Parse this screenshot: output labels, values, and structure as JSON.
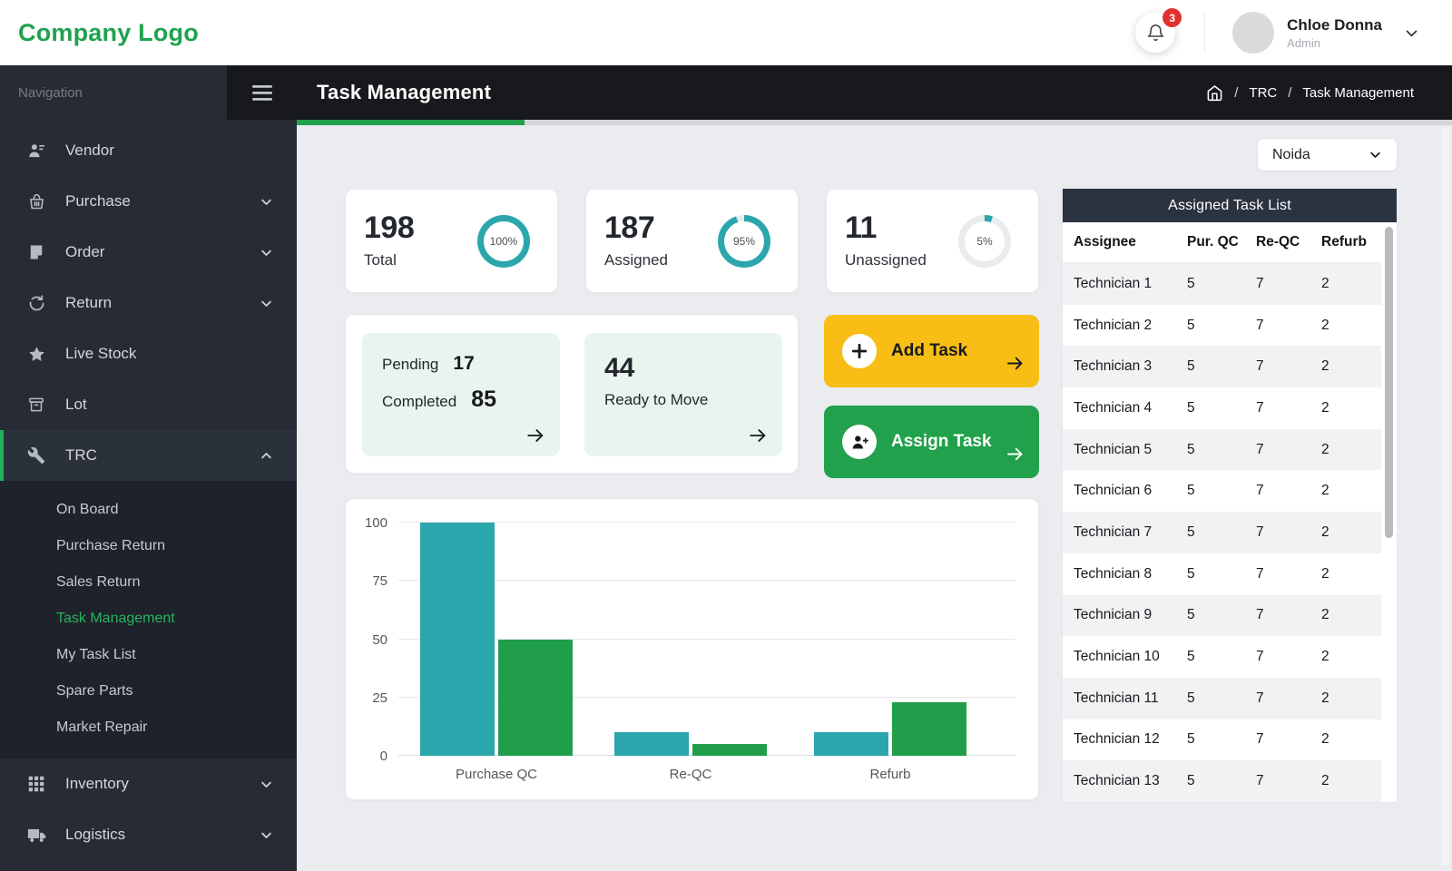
{
  "colors": {
    "green": "#21a14b",
    "green_bright": "#28b45e",
    "teal": "#2ca6ad",
    "yellow": "#f8be15",
    "red": "#e03131",
    "dark": "#17191d",
    "table_header_navy": "#2c3340",
    "mint": "#e9f4ee",
    "ring_track": "#e9ebee"
  },
  "header": {
    "logo": "Company Logo",
    "notification_badge": "3",
    "user_name": "Chloe Donna",
    "user_role": "Admin"
  },
  "sidebar": {
    "nav_label": "Navigation",
    "items": [
      {
        "id": "vendor",
        "label": "Vendor",
        "icon": "vendor-icon"
      },
      {
        "id": "purchase",
        "label": "Purchase",
        "icon": "basket-icon",
        "expandable": true,
        "expanded": false
      },
      {
        "id": "order",
        "label": "Order",
        "icon": "note-icon",
        "expandable": true,
        "expanded": false
      },
      {
        "id": "return",
        "label": "Return",
        "icon": "return-icon",
        "expandable": true,
        "expanded": false
      },
      {
        "id": "live-stock",
        "label": "Live Stock",
        "icon": "star-icon"
      },
      {
        "id": "lot",
        "label": "Lot",
        "icon": "archive-icon"
      },
      {
        "id": "trc",
        "label": "TRC",
        "icon": "wrench-icon",
        "expandable": true,
        "expanded": true,
        "active": true,
        "children": [
          {
            "id": "on-board",
            "label": "On Board"
          },
          {
            "id": "purchase-return",
            "label": "Purchase Return"
          },
          {
            "id": "sales-return",
            "label": "Sales Return"
          },
          {
            "id": "task-management",
            "label": "Task Management",
            "active": true
          },
          {
            "id": "my-task-list",
            "label": "My Task List"
          },
          {
            "id": "spare-parts",
            "label": "Spare Parts"
          },
          {
            "id": "market-repair",
            "label": "Market Repair"
          }
        ]
      },
      {
        "id": "inventory",
        "label": "Inventory",
        "icon": "grid-icon",
        "expandable": true,
        "expanded": false
      },
      {
        "id": "logistics",
        "label": "Logistics",
        "icon": "truck-icon",
        "expandable": true,
        "expanded": false
      }
    ]
  },
  "titlebar": {
    "title": "Task Management",
    "breadcrumb": [
      "TRC",
      "Task Management"
    ]
  },
  "filters": {
    "location": "Noida"
  },
  "stats": [
    {
      "value": "198",
      "label": "Total",
      "percent": 100,
      "percent_label": "100%"
    },
    {
      "value": "187",
      "label": "Assigned",
      "percent": 95,
      "percent_label": "95%"
    },
    {
      "value": "11",
      "label": "Unassigned",
      "percent": 5,
      "percent_label": "5%"
    }
  ],
  "summary": {
    "pending_label": "Pending",
    "pending_value": "17",
    "completed_label": "Completed",
    "completed_value": "85",
    "ready_value": "44",
    "ready_label": "Ready to Move"
  },
  "actions": {
    "add_task": "Add Task",
    "assign_task": "Assign Task"
  },
  "chart_data": {
    "type": "bar",
    "categories": [
      "Purchase QC",
      "Re-QC",
      "Refurb"
    ],
    "series": [
      {
        "name": "series-1",
        "color": "#2ca6ad",
        "values": [
          100,
          10,
          10
        ]
      },
      {
        "name": "series-2",
        "color": "#219e4a",
        "values": [
          50,
          5,
          23
        ]
      }
    ],
    "yticks": [
      0,
      25,
      50,
      75,
      100
    ],
    "ylim": [
      0,
      100
    ],
    "grid": true,
    "legend": false
  },
  "table": {
    "title": "Assigned Task List",
    "columns": [
      "Assignee",
      "Pur. QC",
      "Re-QC",
      "Refurb"
    ],
    "rows": [
      [
        "Technician 1",
        "5",
        "7",
        "2"
      ],
      [
        "Technician 2",
        "5",
        "7",
        "2"
      ],
      [
        "Technician 3",
        "5",
        "7",
        "2"
      ],
      [
        "Technician 4",
        "5",
        "7",
        "2"
      ],
      [
        "Technician 5",
        "5",
        "7",
        "2"
      ],
      [
        "Technician 6",
        "5",
        "7",
        "2"
      ],
      [
        "Technician 7",
        "5",
        "7",
        "2"
      ],
      [
        "Technician 8",
        "5",
        "7",
        "2"
      ],
      [
        "Technician 9",
        "5",
        "7",
        "2"
      ],
      [
        "Technician 10",
        "5",
        "7",
        "2"
      ],
      [
        "Technician 11",
        "5",
        "7",
        "2"
      ],
      [
        "Technician 12",
        "5",
        "7",
        "2"
      ],
      [
        "Technician 13",
        "5",
        "7",
        "2"
      ]
    ]
  }
}
